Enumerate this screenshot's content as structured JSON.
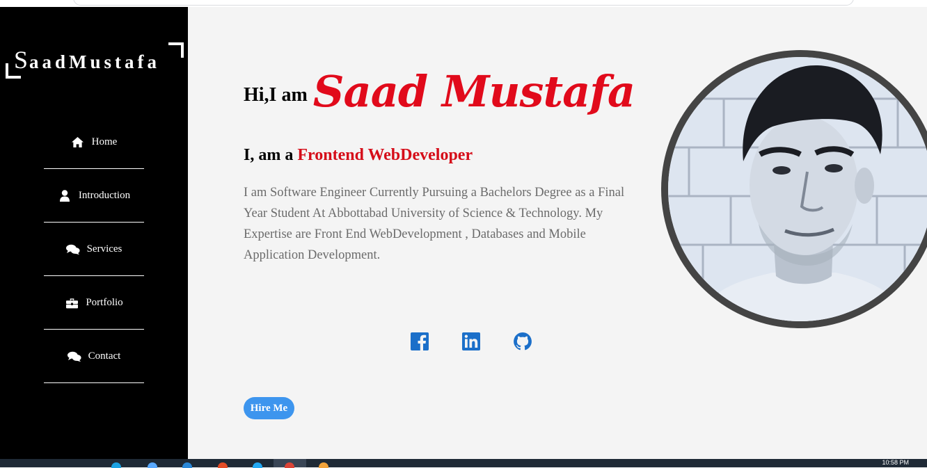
{
  "logo": {
    "initial": "S",
    "rest": "aadMustafa"
  },
  "nav": [
    {
      "icon": "home-icon",
      "label": "Home"
    },
    {
      "icon": "user-icon",
      "label": "Introduction"
    },
    {
      "icon": "comments-icon",
      "label": "Services"
    },
    {
      "icon": "briefcase-icon",
      "label": "Portfolio"
    },
    {
      "icon": "comments-icon",
      "label": "Contact"
    }
  ],
  "hero": {
    "greeting": "Hi,I am",
    "name": "Saad Mustafa",
    "subtitle_prefix": "I, am a",
    "role": "Frontend WebDeveloper",
    "bio": "I am Software Engineer Currently Pursuing a Bachelors Degree as a Final Year Student At Abbottabad University of Science & Technology. My Expertise are Front End WebDevelopment , Databases and Mobile Application Development."
  },
  "socials": [
    {
      "icon": "facebook-icon"
    },
    {
      "icon": "linkedin-icon"
    },
    {
      "icon": "github-icon"
    }
  ],
  "hire_button": "Hire Me",
  "taskbar": {
    "clock": "10:58 PM"
  },
  "colors": {
    "accent_red": "#e10a1b",
    "social_blue": "#1b6fc9",
    "button_blue": "#3d95ee",
    "sidebar": "#000000"
  }
}
